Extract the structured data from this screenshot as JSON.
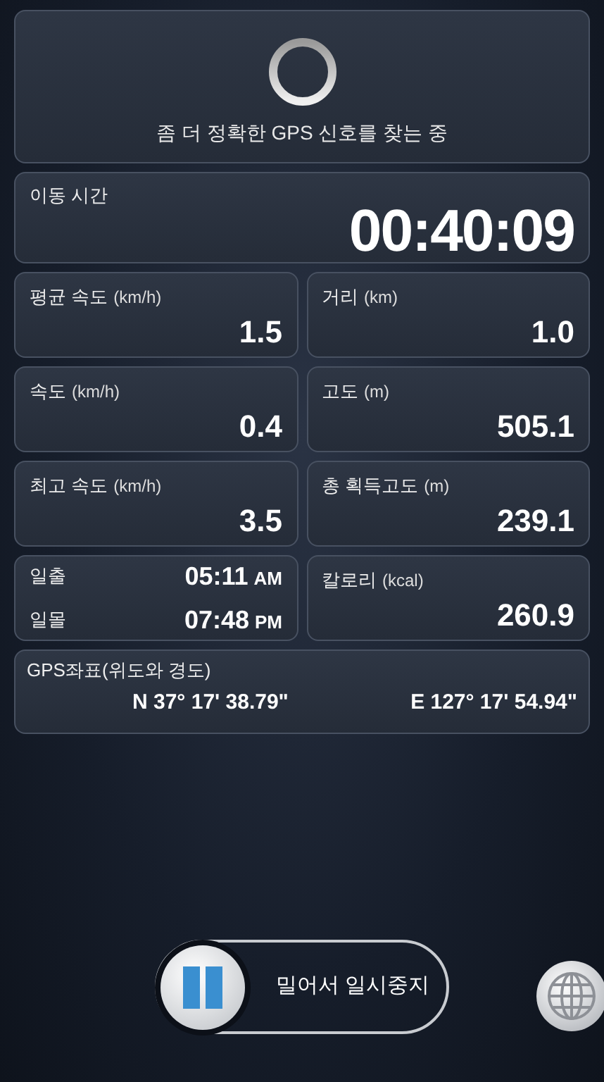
{
  "gps_status": {
    "text": "좀 더 정확한 GPS 신호를 찾는 중"
  },
  "moving_time": {
    "label": "이동 시간",
    "value": "00:40:09"
  },
  "stats": [
    {
      "label": "평균 속도",
      "unit": "(km/h)",
      "value": "1.5"
    },
    {
      "label": "거리",
      "unit": "(km)",
      "value": "1.0"
    },
    {
      "label": "속도",
      "unit": "(km/h)",
      "value": "0.4"
    },
    {
      "label": "고도",
      "unit": "(m)",
      "value": "505.1"
    },
    {
      "label": "최고 속도",
      "unit": "(km/h)",
      "value": "3.5"
    },
    {
      "label": "총 획득고도",
      "unit": "(m)",
      "value": "239.1"
    }
  ],
  "sun": [
    {
      "label": "일출",
      "time": "05:11",
      "suffix": "AM"
    },
    {
      "label": "일몰",
      "time": "07:48",
      "suffix": "PM"
    }
  ],
  "calories": {
    "label": "칼로리",
    "unit": "(kcal)",
    "value": "260.9"
  },
  "coordinates": {
    "label": "GPS좌표(위도와 경도)",
    "latitude": "N 37° 17' 38.79\"",
    "longitude": "E 127° 17' 54.94\""
  },
  "slider": {
    "label": "밀어서 일시중지",
    "level": 0
  }
}
